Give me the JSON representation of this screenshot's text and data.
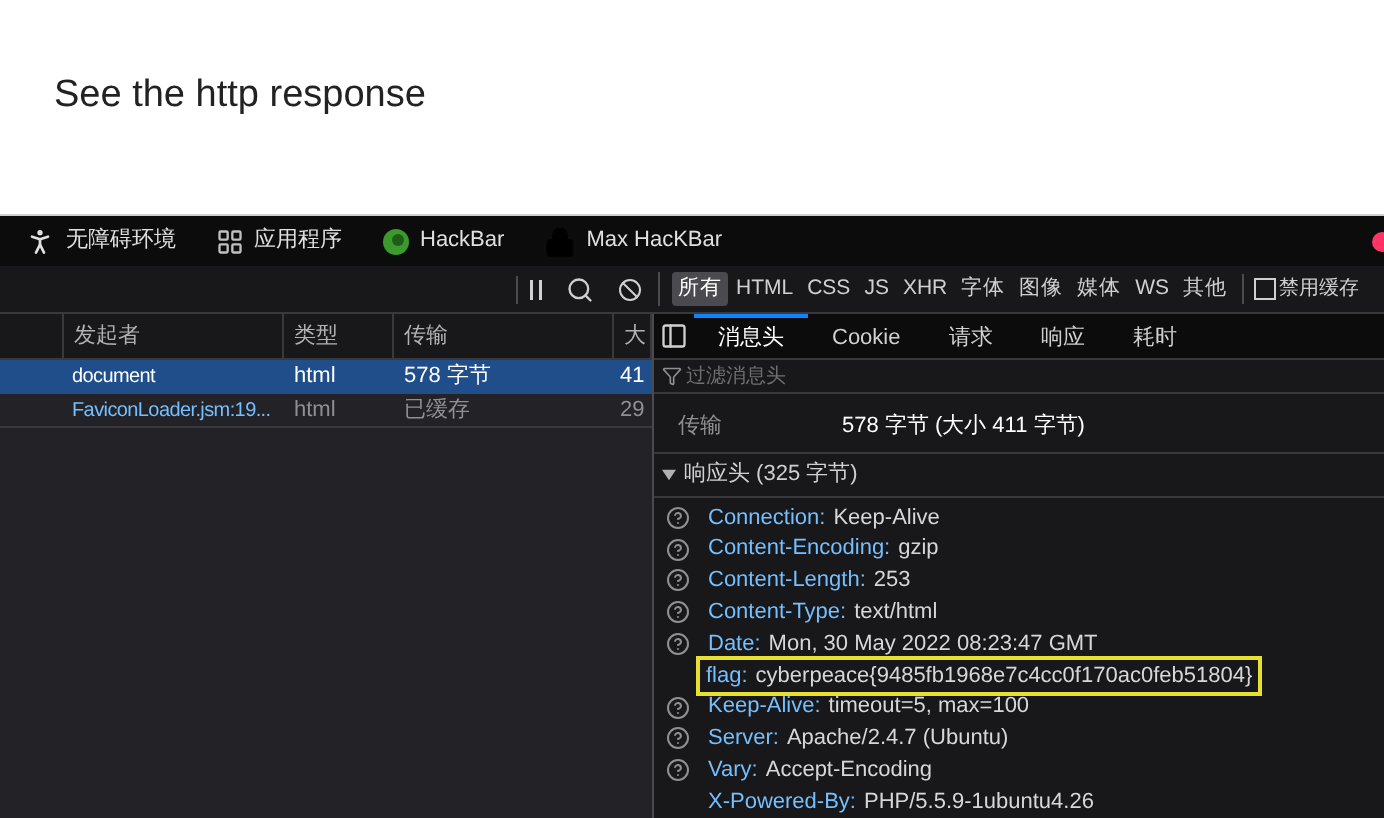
{
  "page": {
    "heading": "See the http response"
  },
  "bookmarks": [
    {
      "label": "无障碍环境",
      "kind": "person"
    },
    {
      "label": "应用程序",
      "kind": "grid"
    },
    {
      "label": "HackBar",
      "kind": "green"
    },
    {
      "label": "Max HacKBar",
      "kind": "lock"
    }
  ],
  "network_toolbar": {
    "filters": [
      {
        "label": "所有",
        "selected": true
      },
      {
        "label": "HTML",
        "selected": false
      },
      {
        "label": "CSS",
        "selected": false
      },
      {
        "label": "JS",
        "selected": false
      },
      {
        "label": "XHR",
        "selected": false
      },
      {
        "label": "字体",
        "selected": false
      },
      {
        "label": "图像",
        "selected": false
      },
      {
        "label": "媒体",
        "selected": false
      },
      {
        "label": "WS",
        "selected": false
      },
      {
        "label": "其他",
        "selected": false
      }
    ],
    "disable_cache": {
      "label": "禁用缓存",
      "checked": false
    }
  },
  "requests": {
    "columns": [
      "发起者",
      "类型",
      "传输",
      "大"
    ],
    "rows": [
      {
        "initiator": "document",
        "type": "html",
        "transferred": "578 字节",
        "size": "41",
        "selected": true,
        "link": false
      },
      {
        "initiator": "FaviconLoader.jsm:19...",
        "type": "html",
        "transferred": "已缓存",
        "size": "29",
        "selected": false,
        "link": true
      }
    ]
  },
  "details": {
    "tabs": [
      {
        "label": "消息头",
        "selected": true
      },
      {
        "label": "Cookie",
        "selected": false
      },
      {
        "label": "请求",
        "selected": false
      },
      {
        "label": "响应",
        "selected": false
      },
      {
        "label": "耗时",
        "selected": false
      }
    ],
    "filter": {
      "placeholder": "过滤消息头"
    },
    "summary": [
      {
        "label": "传输",
        "value": "578 字节 (大小 411 字节)"
      }
    ],
    "response_headers": {
      "title": "响应头 (325 字节)",
      "expanded": true,
      "headers": [
        {
          "name": "Connection:",
          "value": "Keep-Alive",
          "help": true,
          "highlighted": false
        },
        {
          "name": "Content-Encoding:",
          "value": "gzip",
          "help": true,
          "highlighted": false
        },
        {
          "name": "Content-Length:",
          "value": "253",
          "help": true,
          "highlighted": false
        },
        {
          "name": "Content-Type:",
          "value": "text/html",
          "help": true,
          "highlighted": false
        },
        {
          "name": "Date:",
          "value": "Mon, 30 May 2022 08:23:47 GMT",
          "help": true,
          "highlighted": false
        },
        {
          "name": "flag:",
          "value": "cyberpeace{9485fb1968e7c4cc0f170ac0feb51804}",
          "help": false,
          "highlighted": true
        },
        {
          "name": "Keep-Alive:",
          "value": "timeout=5, max=100",
          "help": true,
          "highlighted": false
        },
        {
          "name": "Server:",
          "value": "Apache/2.4.7 (Ubuntu)",
          "help": true,
          "highlighted": false
        },
        {
          "name": "Vary:",
          "value": "Accept-Encoding",
          "help": true,
          "highlighted": false
        },
        {
          "name": "X-Powered-By:",
          "value": "PHP/5.5.9-1ubuntu4.26",
          "help": false,
          "highlighted": false
        }
      ]
    }
  }
}
